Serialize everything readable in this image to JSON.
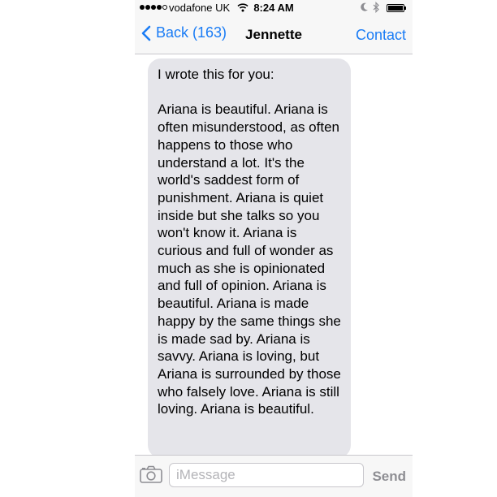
{
  "status_bar": {
    "carrier": "vodafone UK",
    "time": "8:24 AM",
    "signal_bars_filled": 4,
    "signal_bars_total": 5,
    "icons": [
      "signal-icon",
      "wifi-icon",
      "moon-icon",
      "bluetooth-icon",
      "battery-icon"
    ]
  },
  "nav": {
    "back_label": "Back (163)",
    "title": "Jennette",
    "contact_label": "Contact",
    "accent_color": "#1a7cf5"
  },
  "messages": [
    {
      "direction": "incoming",
      "text": "I wrote this for you:\n\nAriana is beautiful. Ariana is often misunderstood, as often happens to those who understand a lot. It's the world's saddest form of punishment. Ariana is quiet inside but she talks so you won't know it. Ariana is curious and full of wonder as much as she is opinionated and full of opinion. Ariana is beautiful. Ariana is made happy by the same things she is made sad by. Ariana is savvy. Ariana is loving, but Ariana is surrounded by those who falsely love. Ariana is still loving. Ariana is beautiful."
    }
  ],
  "compose": {
    "placeholder": "iMessage",
    "value": "",
    "send_label": "Send"
  },
  "colors": {
    "bubble_incoming": "#e5e5ea",
    "send_disabled": "#8e8e93"
  }
}
